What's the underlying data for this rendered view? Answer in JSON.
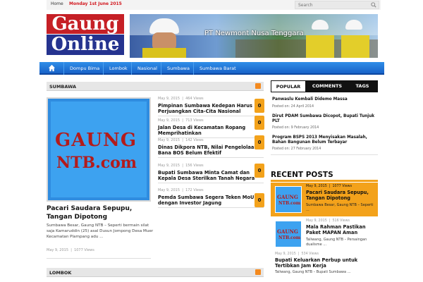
{
  "topbar": {
    "home": "Home",
    "date": "Monday 1st June 2015",
    "search_placeholder": "Search"
  },
  "logo": {
    "line1": "Gaung",
    "line2": "Online"
  },
  "banner": {
    "caption": "PT Newmont Nusa Tenggara"
  },
  "nav": {
    "items": [
      "Dompu Bima",
      "Lombok",
      "Nasional",
      "Sumbawa",
      "Sumbawa Barat"
    ]
  },
  "sections": {
    "sumbawa": "SUMBAWA",
    "lombok": "LOMBOK"
  },
  "featured": {
    "image_text": [
      "GAUNG",
      "NTB.com"
    ],
    "title": "Pacari Saudara Sepupu, Tangan Dipotong",
    "excerpt": "Sumbawa Besar, Gaung NTB – Seperti bermain silat saja Kamaruddin (25) asal Dusun Jompong Desa Muer Kecamatan Plampang adu ...",
    "date": "May 9, 2015",
    "views": "1077 Views"
  },
  "posts": [
    {
      "date": "May 9, 2015",
      "views": "464 Views",
      "title": "Pimpinan Sumbawa Kedepan Harus Perjuangkan Cita-Cita Nasional",
      "comments": "0"
    },
    {
      "date": "May 9, 2015",
      "views": "713 Views",
      "title": "Jalan Desa di Kecamatan Ropang Memprihatinkan",
      "comments": "0"
    },
    {
      "date": "May 9, 2015",
      "views": "142 Views",
      "title": "Dinas Dikpora NTB, Nilai Pengelolaan Bana BOS Belum Efektif",
      "comments": "0"
    },
    {
      "date": "May 9, 2015",
      "views": "156 Views",
      "title": "Bupati Sumbawa Minta Camat dan Kepala Desa Sterilkan Tanah Negara",
      "comments": "0"
    },
    {
      "date": "May 9, 2015",
      "views": "172 Views",
      "title": "Pemda Sumbawa Segera Teken MoU dengan Investor Jagung",
      "comments": "0"
    }
  ],
  "tabs": [
    "POPULAR",
    "COMMENTS",
    "TAGS"
  ],
  "popular": [
    {
      "title": "Panwaslu Kembali Didemo Massa",
      "date": "Posted on: 24 April 2014"
    },
    {
      "title": "Dirut PDAM Sumbawa Dicopot, Bupati Tunjuk PLT",
      "date": "Posted on: 9 February 2014"
    },
    {
      "title": "Program BSPS 2013 Menyisakan Masalah, Bahan Bangunan Belum Terbayar",
      "date": "Posted on: 27 February 2014"
    }
  ],
  "recent": {
    "heading": "RECENT POSTS",
    "thumb_text": [
      "GAUNG",
      "NTB.com"
    ],
    "items": [
      {
        "date": "May 9, 2015",
        "views": "1077 Views",
        "title": "Pacari Saudara Sepupu, Tangan Dipotong",
        "excerpt": "Sumbawa Besar, Gaung NTB – Seperti ..."
      },
      {
        "date": "May 9, 2015",
        "views": "516 Views",
        "title": "Mala Rahman Pastikan Paket MAPAN Aman",
        "excerpt": "Taliwang, Gaung NTB – Persaingan dualisme ..."
      },
      {
        "date": "May 9, 2015",
        "views": "534 Views",
        "title": "Bupati Keluarkan Perbup untuk Tertibkan Jam Kerja",
        "excerpt": "Taliwang, Gaung NTB – Bupati Sumbawa ..."
      }
    ]
  },
  "colors": {
    "accent_orange": "#f3a21b",
    "nav_blue": "#1e72d6",
    "logo_red": "#c62026",
    "logo_blue": "#25338f"
  }
}
